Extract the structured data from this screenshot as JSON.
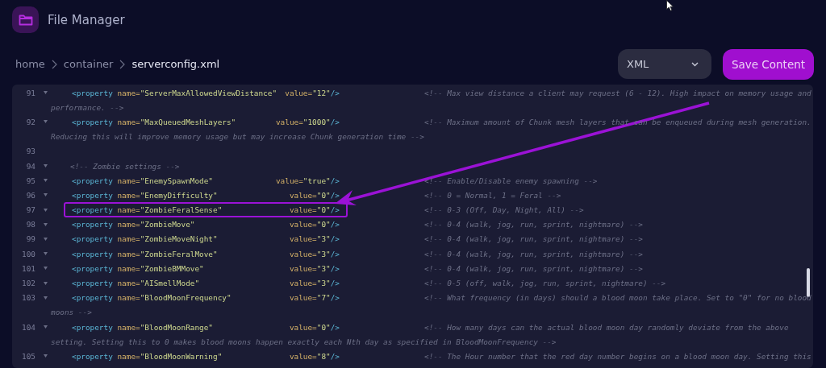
{
  "app": {
    "title": "File Manager"
  },
  "breadcrumb": [
    {
      "label": "home",
      "current": false
    },
    {
      "label": "container",
      "current": false
    },
    {
      "label": "serverconfig.xml",
      "current": true
    }
  ],
  "format_select": {
    "value": "XML"
  },
  "save_button": {
    "label": "Save Content"
  },
  "editor": {
    "lines": [
      {
        "kind": "property",
        "number": "91",
        "tag": "<property",
        "attr": "name=",
        "name": "\"ServerMaxAllowedViewDistance\"",
        "value_attr": "value=",
        "value": "\"12\"",
        "close": " />",
        "comment": "<!-- Max view distance a client may request (6 - 12). High impact on memory usage and",
        "continuation": "performance. -->",
        "highlighted": false
      },
      {
        "kind": "property",
        "number": "92",
        "tag": "<property",
        "attr": "name=",
        "name": "\"MaxQueuedMeshLayers\"",
        "value_attr": "value=",
        "value": "\"1000\"",
        "close": " />",
        "comment": "<!-- Maximum amount of Chunk mesh layers that can be enqueued during mesh generation.",
        "continuation": "Reducing this will improve memory usage but may increase Chunk generation time -->",
        "highlighted": false
      },
      {
        "kind": "blank",
        "number": "93"
      },
      {
        "kind": "comment",
        "number": "94",
        "comment": "<!-- Zombie settings -->"
      },
      {
        "kind": "property",
        "number": "95",
        "tag": "<property",
        "attr": "name=",
        "name": "\"EnemySpawnMode\"",
        "value_attr": "value=",
        "value": "\"true\"",
        "close": "/>",
        "comment": "<!-- Enable/Disable enemy spawning -->",
        "highlighted": false
      },
      {
        "kind": "property",
        "number": "96",
        "tag": "<property",
        "attr": "name=",
        "name": "\"EnemyDifficulty\"",
        "value_attr": "value=",
        "value": "\"0\"",
        "close": "/>",
        "comment": "<!-- 0 = Normal, 1 = Feral -->",
        "highlighted": false
      },
      {
        "kind": "property",
        "number": "97",
        "tag": "<property",
        "attr": "name=",
        "name": "\"ZombieFeralSense\"",
        "value_attr": "value=",
        "value": "\"0\"",
        "close": "/>",
        "comment": "<!-- 0-3 (Off, Day, Night, All) -->",
        "highlighted": true
      },
      {
        "kind": "property",
        "number": "98",
        "tag": "<property",
        "attr": "name=",
        "name": "\"ZombieMove\"",
        "value_attr": "value=",
        "value": "\"0\"",
        "close": "/>",
        "comment": "<!-- 0-4 (walk, jog, run, sprint, nightmare) -->",
        "highlighted": false
      },
      {
        "kind": "property",
        "number": "99",
        "tag": "<property",
        "attr": "name=",
        "name": "\"ZombieMoveNight\"",
        "value_attr": "value=",
        "value": "\"3\"",
        "close": "/>",
        "comment": "<!-- 0-4 (walk, jog, run, sprint, nightmare) -->",
        "highlighted": false
      },
      {
        "kind": "property",
        "number": "100",
        "tag": "<property",
        "attr": "name=",
        "name": "\"ZombieFeralMove\"",
        "value_attr": "value=",
        "value": "\"3\"",
        "close": "/>",
        "comment": "<!-- 0-4 (walk, jog, run, sprint, nightmare) -->",
        "highlighted": false
      },
      {
        "kind": "property",
        "number": "101",
        "tag": "<property",
        "attr": "name=",
        "name": "\"ZombieBMMove\"",
        "value_attr": "value=",
        "value": "\"3\"",
        "close": "/>",
        "comment": "<!-- 0-4 (walk, jog, run, sprint, nightmare) -->",
        "highlighted": false
      },
      {
        "kind": "property",
        "number": "102",
        "tag": "<property",
        "attr": "name=",
        "name": "\"AISmellMode\"",
        "value_attr": "value=",
        "value": "\"3\"",
        "close": "/>",
        "comment": "<!-- 0-5 (off, walk, jog, run, sprint, nightmare) -->",
        "highlighted": false
      },
      {
        "kind": "property",
        "number": "103",
        "tag": "<property",
        "attr": "name=",
        "name": "\"BloodMoonFrequency\"",
        "value_attr": "value=",
        "value": "\"7\"",
        "close": "/>",
        "comment": "<!-- What frequency (in days) should a blood moon take place. Set to \"0\" for no blood",
        "continuation": "moons -->",
        "highlighted": false
      },
      {
        "kind": "property",
        "number": "104",
        "tag": "<property",
        "attr": "name=",
        "name": "\"BloodMoonRange\"",
        "value_attr": "value=",
        "value": "\"0\"",
        "close": "/>",
        "comment": "<!-- How many days can the actual blood moon day randomly deviate from the above",
        "continuation": "setting. Setting this to 0 makes blood moons happen exactly each Nth day as specified in BloodMoonFrequency -->",
        "highlighted": false
      },
      {
        "kind": "property",
        "number": "105",
        "tag": "<property",
        "attr": "name=",
        "name": "\"BloodMoonWarning\"",
        "value_attr": "value=",
        "value": "\"8\"",
        "close": "/>",
        "comment": "<!-- The Hour number that the red day number begins on a blood moon day. Setting this",
        "highlighted": false
      }
    ]
  }
}
